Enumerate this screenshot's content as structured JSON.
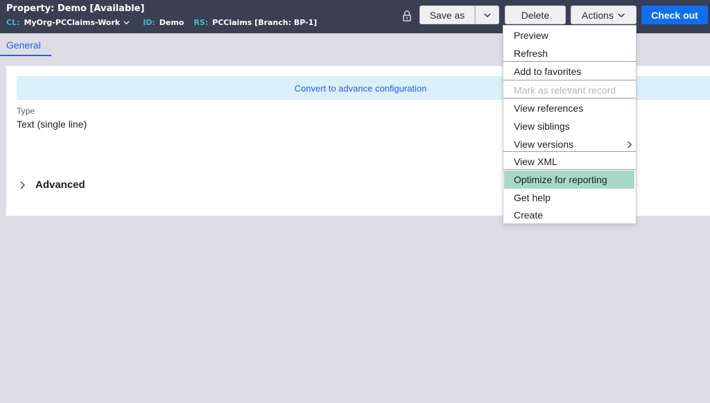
{
  "header": {
    "title": "Property: Demo [Available]",
    "meta": {
      "cl_key": "CL:",
      "cl_value": "MyOrg-PCClaims-Work",
      "id_key": "ID:",
      "id_value": "Demo",
      "rs_key": "RS:",
      "rs_value": "PCClaims [Branch: BP-1]"
    }
  },
  "toolbar": {
    "save_as_label": "Save as",
    "delete_label": "Delete",
    "actions_label": "Actions",
    "check_out_label": "Check out"
  },
  "tabs": [
    {
      "label": "General",
      "active": true
    }
  ],
  "main": {
    "banner_link": "Convert to advance configuration",
    "type_label": "Type",
    "type_value": "Text (single line)",
    "advanced_label": "Advanced"
  },
  "actions_menu": {
    "items": [
      {
        "label": "Preview"
      },
      {
        "label": "Refresh"
      },
      {
        "label": "Add to favorites"
      },
      {
        "label": "Mark as relevant record",
        "disabled": true
      },
      {
        "label": "View references"
      },
      {
        "label": "View siblings"
      },
      {
        "label": "View versions",
        "has_submenu": true
      },
      {
        "label": "View XML"
      },
      {
        "label": "Optimize for reporting",
        "highlighted": true
      },
      {
        "label": "Get help"
      },
      {
        "label": "Create"
      }
    ]
  },
  "colors": {
    "header_bg": "#3b3f52",
    "meta_key": "#37c0c9",
    "primary": "#0d6ff2",
    "link": "#2a5fe6",
    "banner_bg": "#daf0fb",
    "menu_highlight": "#a8d9c6",
    "page_bg": "#dddde3"
  },
  "icons": [
    "lock-icon",
    "chevron-down-icon",
    "chevron-right-icon"
  ]
}
